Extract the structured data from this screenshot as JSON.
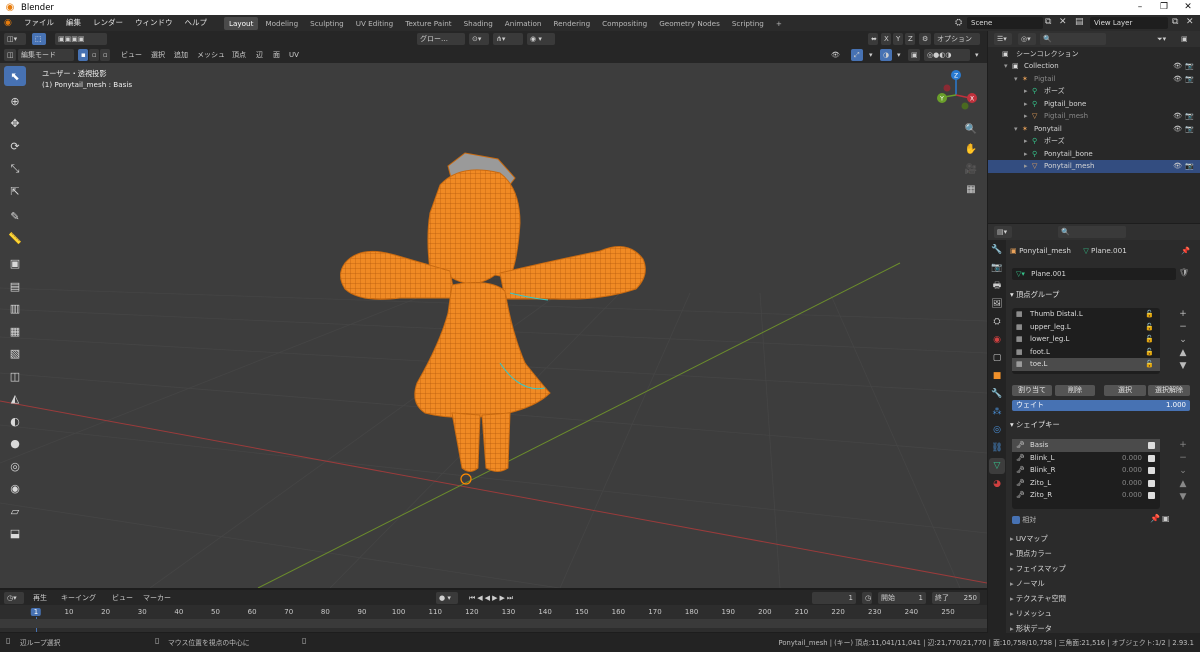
{
  "window": {
    "title": "Blender",
    "app_logo": "blender-logo",
    "controls": [
      "–",
      "❐",
      "✕"
    ]
  },
  "menubar": {
    "items": [
      "ファイル",
      "編集",
      "レンダー",
      "ウィンドウ",
      "ヘルプ"
    ]
  },
  "workspaces": {
    "tabs": [
      "Layout",
      "Modeling",
      "Sculpting",
      "UV Editing",
      "Texture Paint",
      "Shading",
      "Animation",
      "Rendering",
      "Compositing",
      "Geometry Nodes",
      "Scripting"
    ],
    "active": "Layout",
    "add": "+"
  },
  "scene": {
    "name": "Scene",
    "view_layer": "View Layer"
  },
  "viewport_header": {
    "transform_orientation": "グロー…",
    "axes": [
      "X",
      "Y",
      "Z"
    ],
    "options": "オプション",
    "mode": "編集モード",
    "menus": [
      "ビュー",
      "選択",
      "追加",
      "メッシュ",
      "頂点",
      "辺",
      "面",
      "UV"
    ]
  },
  "viewport": {
    "view_name": "ユーザー・透視投影",
    "object_info": "(1) Ponytail_mesh : Basis",
    "gizmo": {
      "x": "X",
      "y": "Y",
      "z": "Z"
    },
    "colors": {
      "background": "#3d3d3d",
      "mesh": "#f08a24",
      "x_axis": "#9b3b3b",
      "y_axis": "#6b8c2c",
      "seam": "#37c8c8"
    }
  },
  "tools": [
    "cursor-select-icon",
    "cursor-3d-icon",
    "move-icon",
    "rotate-icon",
    "scale-icon",
    "transform-icon",
    "annotate-icon",
    "measure-icon",
    "add-cube-icon",
    "extrude-icon",
    "inset-icon",
    "bevel-icon",
    "loop-cut-icon",
    "knife-icon",
    "poly-build-icon",
    "spin-icon",
    "smooth-icon",
    "edge-slide-icon",
    "shrink-fatten-icon",
    "shear-icon",
    "rip-icon"
  ],
  "timeline": {
    "menus": [
      "再生",
      "キーイング",
      "ビュー",
      "マーカー"
    ],
    "current_frame": "1",
    "start_label": "開始",
    "start": "1",
    "end_label": "終了",
    "end": "250",
    "ticks": [
      "1",
      "10",
      "20",
      "30",
      "40",
      "50",
      "60",
      "70",
      "80",
      "90",
      "100",
      "110",
      "120",
      "130",
      "140",
      "150",
      "160",
      "170",
      "180",
      "190",
      "200",
      "210",
      "220",
      "230",
      "240",
      "250"
    ],
    "playhead": 1
  },
  "statusbar": {
    "left1": "辺ループ選択",
    "left2": "マウス位置を視点の中心に",
    "right": "Ponytail_mesh | (キー) 頂点:11,041/11,041 | 辺:21,770/21,770 | 面:10,758/10,758 | 三角面:21,516 | オブジェクト:1/2 | 2.93.1"
  },
  "outliner": {
    "root": "シーンコレクション",
    "rows": [
      {
        "label": "Collection",
        "indent": 1,
        "icon": "collection-icon"
      },
      {
        "label": "Pigtail",
        "indent": 2,
        "icon": "armature-icon",
        "dim": true
      },
      {
        "label": "ポーズ",
        "indent": 3,
        "icon": "pose-icon"
      },
      {
        "label": "Pigtail_bone",
        "indent": 3,
        "icon": "bone-icon"
      },
      {
        "label": "Pigtail_mesh",
        "indent": 3,
        "icon": "mesh-icon",
        "dim": true
      },
      {
        "label": "Ponytail",
        "indent": 2,
        "icon": "armature-icon"
      },
      {
        "label": "ポーズ",
        "indent": 3,
        "icon": "pose-icon"
      },
      {
        "label": "Ponytail_bone",
        "indent": 3,
        "icon": "bone-icon"
      },
      {
        "label": "Ponytail_mesh",
        "indent": 3,
        "icon": "mesh-icon",
        "selected": true
      }
    ]
  },
  "properties": {
    "object_name": "Ponytail_mesh",
    "data_name": "Plane.001",
    "mesh_field": "Plane.001",
    "vertex_groups": {
      "title": "頂点グループ",
      "items": [
        "Thumb Distal.L",
        "upper_leg.L",
        "lower_leg.L",
        "foot.L",
        "toe.L"
      ],
      "selected": "toe.L",
      "buttons": [
        "割り当て",
        "削除",
        "選択",
        "選択解除"
      ],
      "weight_label": "ウェイト",
      "weight_value": "1.000"
    },
    "shape_keys": {
      "title": "シェイプキー",
      "items": [
        {
          "name": "Basis",
          "value": ""
        },
        {
          "name": "Blink_L",
          "value": "0.000"
        },
        {
          "name": "Blink_R",
          "value": "0.000"
        },
        {
          "name": "Zito_L",
          "value": "0.000"
        },
        {
          "name": "Zito_R",
          "value": "0.000"
        }
      ],
      "selected": "Basis",
      "relative_label": "相対"
    },
    "subpanels": [
      "UVマップ",
      "頂点カラー",
      "フェイスマップ",
      "ノーマル",
      "テクスチャ空間",
      "リメッシュ",
      "形状データ"
    ]
  }
}
